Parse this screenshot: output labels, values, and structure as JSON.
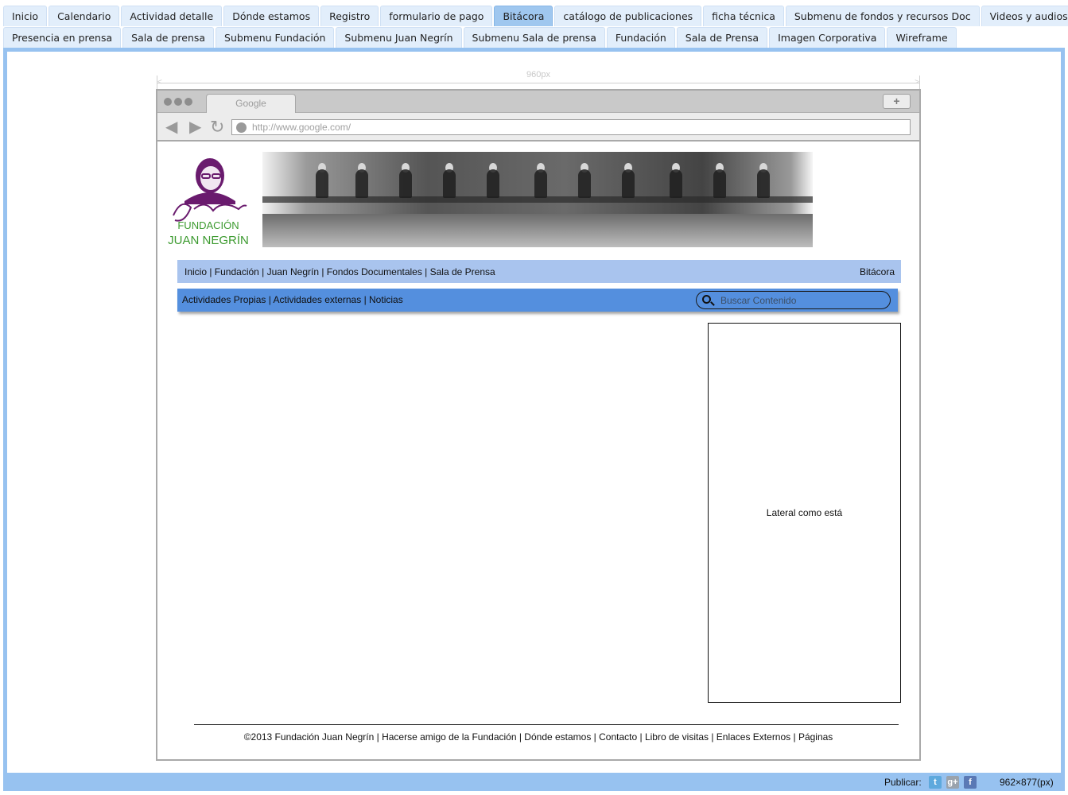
{
  "tabs_row1": [
    "Inicio",
    "Calendario",
    "Actividad detalle",
    "Dónde estamos",
    "Registro",
    "formulario de pago",
    "Bitácora",
    "catálogo de publicaciones",
    "ficha técnica",
    "Submenu de fondos y recursos Doc",
    "Videos y audios"
  ],
  "tabs_row2": [
    "Presencia en prensa",
    "Sala de prensa",
    "Submenu Fundación",
    "Submenu Juan Negrín",
    "Submenu Sala de prensa",
    "Fundación",
    "Sala de Prensa",
    "Imagen Corporativa",
    "Wireframe"
  ],
  "active_tab": "Bitácora",
  "ruler": {
    "label": "960px"
  },
  "browser": {
    "tab_title": "Google",
    "new_tab": "+",
    "url": "http://www.google.com/"
  },
  "logo": {
    "signature": "J. Negrín",
    "line1": "FUNDACIÓN",
    "line2": "JUAN NEGRÍN"
  },
  "nav1": {
    "items": "Inicio | Fundación | Juan Negrín | Fondos Documentales | Sala de Prensa",
    "right": "Bitácora"
  },
  "nav2": {
    "items": "Actividades Propias | Actividades externas | Noticias",
    "search_placeholder": "Buscar Contenido"
  },
  "lateral": {
    "text": "Lateral como está"
  },
  "footer": {
    "text": "©2013 Fundación Juan Negrín | Hacerse amigo de la Fundación | Dónde estamos | Contacto | Libro de visitas | Enlaces Externos | Páginas"
  },
  "status": {
    "publicar": "Publicar:",
    "dimensions": "962×877(px)"
  },
  "colors": {
    "frame": "#97c2f0",
    "tab": "#e2eefb",
    "tab_active": "#9fc7ef",
    "nav1": "#a9c4ee",
    "nav2": "#548fde",
    "logo_purple": "#6a1b6e",
    "logo_green": "#3c9a2f"
  }
}
